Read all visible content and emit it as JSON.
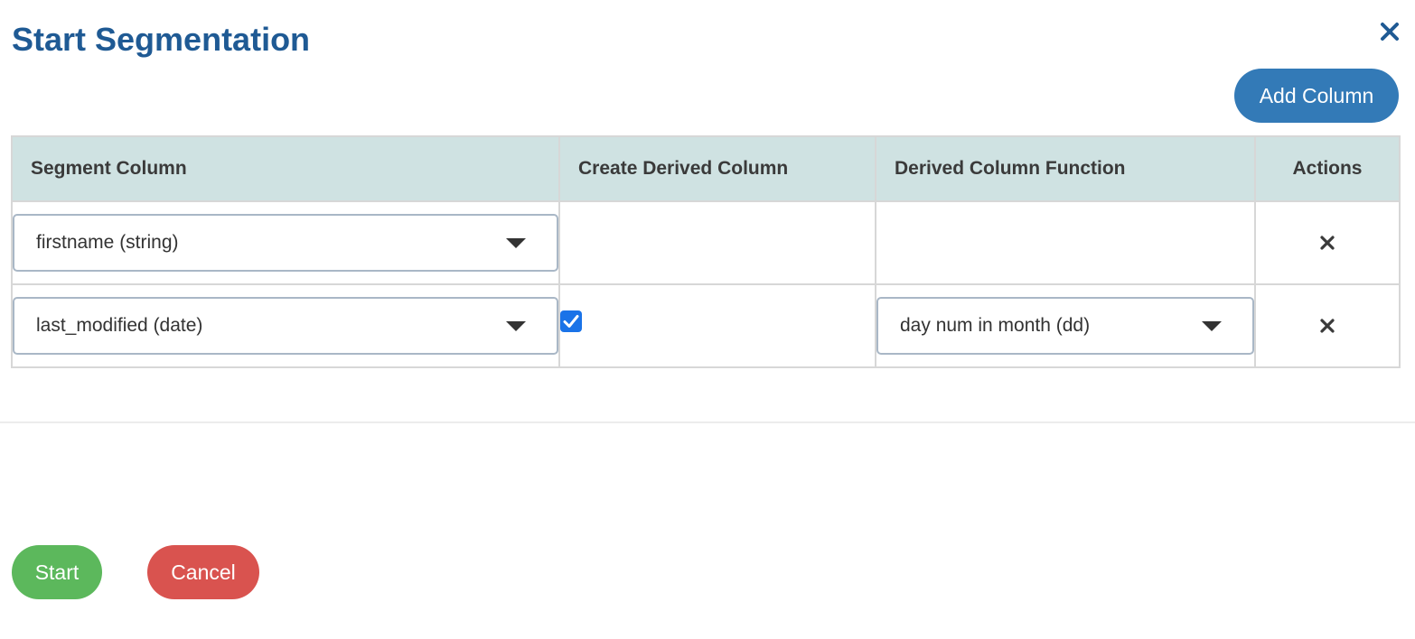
{
  "dialog": {
    "title": "Start Segmentation",
    "close_icon": "close-icon",
    "accent_color": "#1f5a94"
  },
  "toolbar": {
    "add_column_label": "Add Column",
    "add_column_color": "#337ab7"
  },
  "table": {
    "headers": [
      "Segment Column",
      "Create Derived Column",
      "Derived Column Function",
      "Actions"
    ],
    "header_bg": "#cfe2e2",
    "rows": [
      {
        "segment_column": "firstname (string)",
        "create_derived": false,
        "derived_function": null,
        "remove_icon": "remove-icon"
      },
      {
        "segment_column": "last_modified (date)",
        "create_derived": true,
        "derived_function": "day num in month (dd)",
        "remove_icon": "remove-icon"
      }
    ]
  },
  "footer": {
    "start_label": "Start",
    "start_color": "#5cb85c",
    "cancel_label": "Cancel",
    "cancel_color": "#d9534f"
  }
}
